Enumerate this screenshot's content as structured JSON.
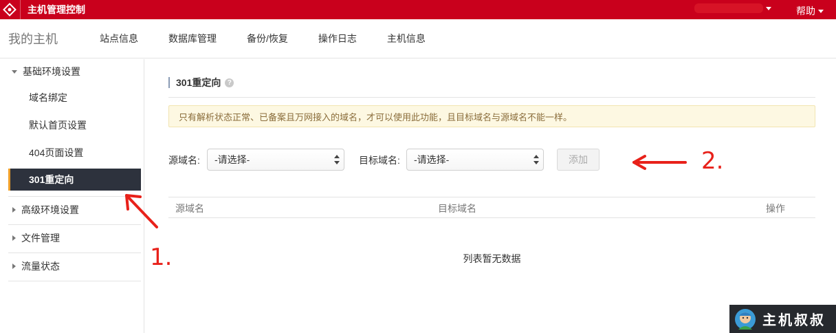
{
  "topbar": {
    "title": "主机管理控制",
    "help_label": "帮助",
    "colors": {
      "brand": "#c9001c"
    }
  },
  "nav": {
    "home": "我的主机",
    "tabs": [
      "站点信息",
      "数据库管理",
      "备份/恢复",
      "操作日志",
      "主机信息"
    ]
  },
  "sidebar": {
    "groups": [
      {
        "label": "基础环境设置",
        "expanded": true,
        "items": [
          "域名绑定",
          "默认首页设置",
          "404页面设置",
          "301重定向"
        ],
        "active": "301重定向"
      },
      {
        "label": "高级环境设置",
        "expanded": false
      },
      {
        "label": "文件管理",
        "expanded": false
      },
      {
        "label": "流量状态",
        "expanded": false
      }
    ],
    "colors": {
      "active_bg": "#2d323d",
      "active_bar": "#f0a02a"
    }
  },
  "main": {
    "section_title": "301重定向",
    "help_icon": "?",
    "notice": "只有解析状态正常、已备案且万网接入的域名，才可以使用此功能，且目标域名与源域名不能一样。",
    "source_label": "源域名:",
    "source_value": "-请选择-",
    "target_label": "目标域名:",
    "target_value": "-请选择-",
    "add_button": "添加",
    "table": {
      "columns": [
        "源域名",
        "目标域名",
        "操作"
      ],
      "empty_text": "列表暂无数据"
    }
  },
  "annotations": {
    "step1": "1.",
    "step2": "2.",
    "color": "#e8211a"
  },
  "watermark": {
    "text": "主机叔叔"
  }
}
